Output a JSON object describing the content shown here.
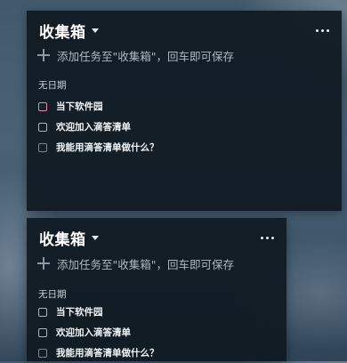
{
  "panels": [
    {
      "title": "收集箱",
      "add_placeholder": "添加任务至\"收集箱\"，回车即可保存",
      "section_label": "无日期",
      "items": [
        {
          "label": "当下软件园"
        },
        {
          "label": "欢迎加入滴答清单"
        },
        {
          "label": "我能用滴答清单做什么？"
        }
      ]
    },
    {
      "title": "收集箱",
      "add_placeholder": "添加任务至\"收集箱\"，回车即可保存",
      "section_label": "无日期",
      "items": [
        {
          "label": "当下软件园"
        },
        {
          "label": "欢迎加入滴答清单"
        },
        {
          "label": "我能用滴答清单做什么？"
        }
      ]
    }
  ],
  "icons": {
    "caret": "caret-down-icon",
    "more": "more-horizontal-icon",
    "add": "plus-icon"
  },
  "colors": {
    "panel_bg": "#101a22",
    "text": "#f1f5f8",
    "muted": "#aeb9c2",
    "first_checkbox_accent": "#e58aa2"
  }
}
